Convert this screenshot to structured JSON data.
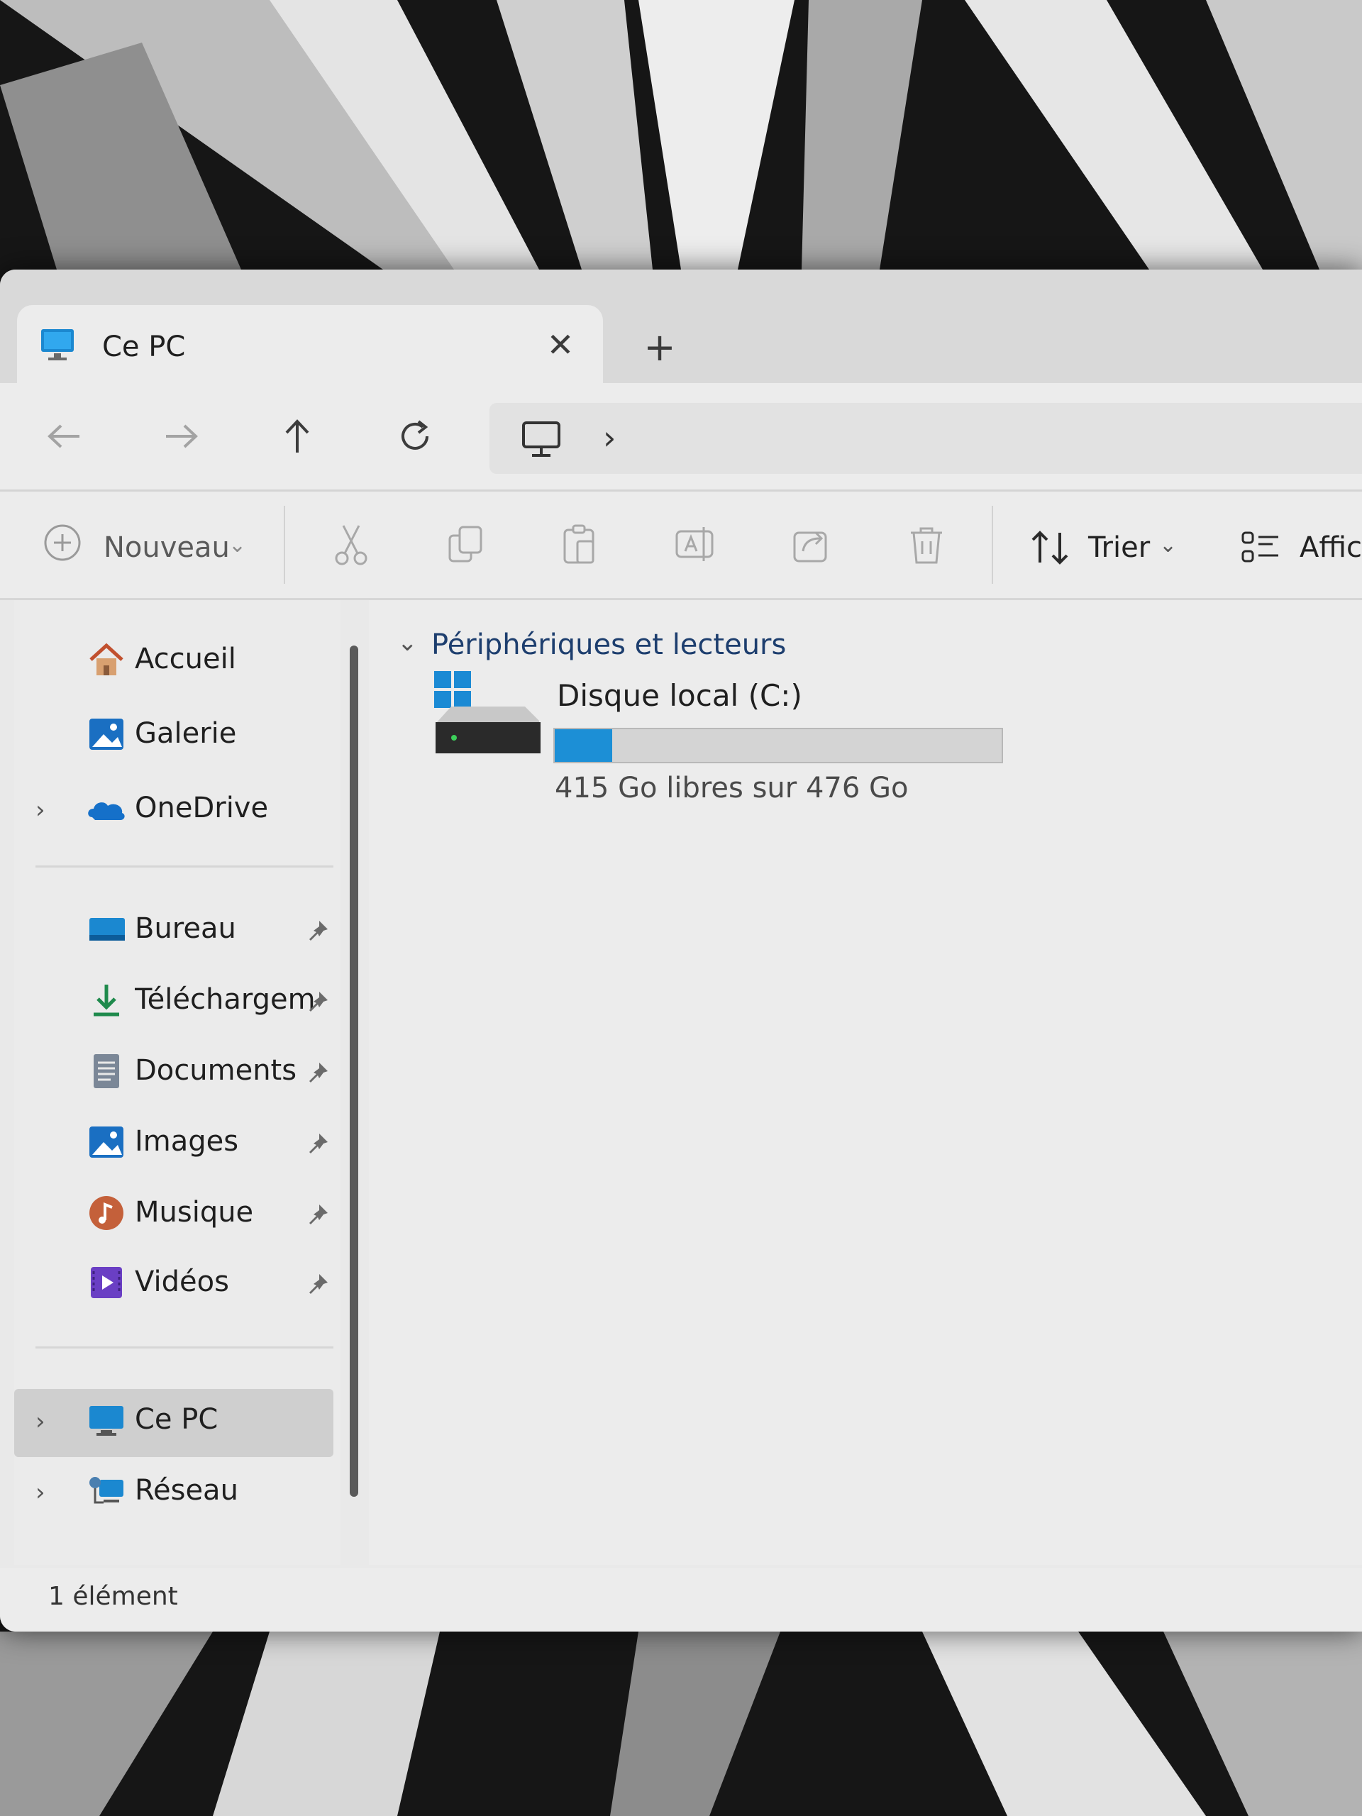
{
  "tab": {
    "title": "Ce PC",
    "close_glyph": "✕",
    "new_glyph": "+"
  },
  "nav": {
    "back": "←",
    "forward": "→",
    "up": "↑",
    "refresh": "⟳",
    "breadcrumb_chevron": "›"
  },
  "toolbar": {
    "new_label": "Nouveau",
    "sort_label": "Trier",
    "view_label": "Affic"
  },
  "sidebar": {
    "items": [
      {
        "label": "Accueil",
        "icon": "home-icon"
      },
      {
        "label": "Galerie",
        "icon": "gallery-icon"
      },
      {
        "label": "OneDrive",
        "icon": "onedrive-icon",
        "expandable": true
      },
      {
        "label": "Bureau",
        "icon": "desktop-icon",
        "pinned": true
      },
      {
        "label": "Téléchargem",
        "icon": "download-icon",
        "pinned": true
      },
      {
        "label": "Documents",
        "icon": "documents-icon",
        "pinned": true
      },
      {
        "label": "Images",
        "icon": "images-icon",
        "pinned": true
      },
      {
        "label": "Musique",
        "icon": "music-icon",
        "pinned": true
      },
      {
        "label": "Vidéos",
        "icon": "videos-icon",
        "pinned": true
      },
      {
        "label": "Ce PC",
        "icon": "pc-icon",
        "expandable": true,
        "selected": true
      },
      {
        "label": "Réseau",
        "icon": "network-icon",
        "expandable": true
      }
    ]
  },
  "content": {
    "group_title": "Périphériques et lecteurs",
    "drive": {
      "name": "Disque local (C:)",
      "free_text": "415 Go libres sur 476 Go",
      "used_fraction": 0.128
    }
  },
  "status": {
    "text": "1 élément"
  },
  "colors": {
    "accent": "#1c8fd6",
    "window_bg": "#ececec"
  }
}
